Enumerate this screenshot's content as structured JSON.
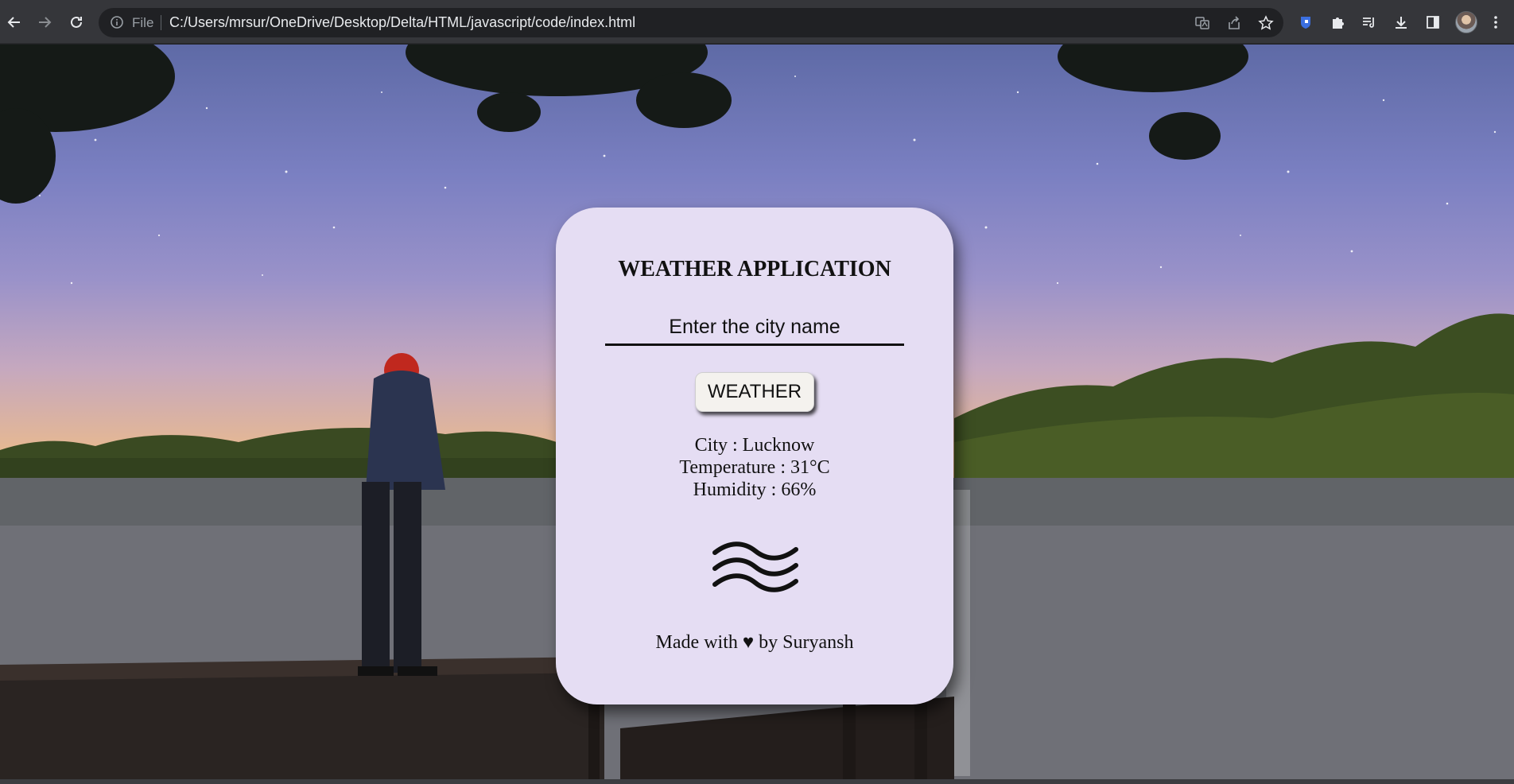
{
  "browser": {
    "scheme_label": "File",
    "url": "C:/Users/mrsur/OneDrive/Desktop/Delta/HTML/javascript/code/index.html",
    "icons": [
      "back-icon",
      "forward-icon",
      "reload-icon",
      "info-icon",
      "translate-icon",
      "share-icon",
      "star-icon",
      "extension-shield-icon",
      "puzzle-icon",
      "reading-list-icon",
      "download-icon",
      "side-panel-icon",
      "avatar",
      "menu-icon"
    ]
  },
  "app": {
    "title": "WEATHER APPLICATION",
    "input_placeholder": "Enter the city name",
    "button_label": "WEATHER",
    "city": "City : Lucknow",
    "temperature": "Temperature : 31°C",
    "humidity": "Humidity : 66%",
    "footer": "Made with ♥ by Suryansh",
    "card_color": "#e5ddf3",
    "weather_icon": "wind-waves-icon"
  }
}
